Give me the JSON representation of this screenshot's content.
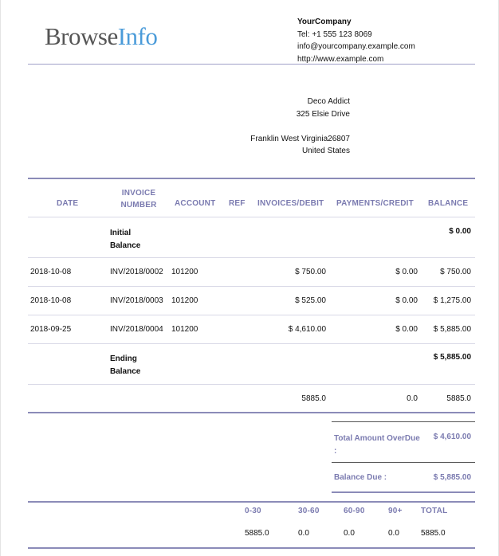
{
  "logo": {
    "part1": "Browse",
    "part2": "Info",
    "accent_color": "#4a9bd9"
  },
  "company": {
    "name": "YourCompany",
    "tel": "Tel: +1 555 123 8069",
    "email": "info@yourcompany.example.com",
    "website": "http://www.example.com"
  },
  "partner": {
    "name": "Deco Addict",
    "street": "325 Elsie Drive",
    "city_line": "Franklin West Virginia26807",
    "country": "United States"
  },
  "table": {
    "headers": {
      "date": "DATE",
      "invoice_line1": "INVOICE",
      "invoice_line2": "NUMBER",
      "account": "ACCOUNT",
      "ref": "REF",
      "debit": "INVOICES/DEBIT",
      "credit": "PAYMENTS/CREDIT",
      "balance": "BALANCE"
    },
    "initial": {
      "label_line1": "Initial",
      "label_line2": "Balance",
      "balance": "$ 0.00"
    },
    "rows": [
      {
        "date": "2018-10-08",
        "invoice": "INV/2018/0002",
        "account": "101200",
        "debit": "$ 750.00",
        "credit": "$ 0.00",
        "balance": "$ 750.00"
      },
      {
        "date": "2018-10-08",
        "invoice": "INV/2018/0003",
        "account": "101200",
        "debit": "$ 525.00",
        "credit": "$ 0.00",
        "balance": "$ 1,275.00"
      },
      {
        "date": "2018-09-25",
        "invoice": "INV/2018/0004",
        "account": "101200",
        "debit": "$ 4,610.00",
        "credit": "$ 0.00",
        "balance": "$ 5,885.00"
      }
    ],
    "ending": {
      "label_line1": "Ending",
      "label_line2": "Balance",
      "balance": "$ 5,885.00"
    },
    "totals": {
      "debit": "5885.0",
      "credit": "0.0",
      "balance": "5885.0"
    }
  },
  "summary": {
    "overdue_label_line1": "Total Amount OverDue",
    "overdue_label_line2": ":",
    "overdue_value": "$ 4,610.00",
    "balance_due_label": "Balance Due :",
    "balance_due_value": "$ 5,885.00"
  },
  "aging": {
    "headers": [
      "0-30",
      "30-60",
      "60-90",
      "90+",
      "TOTAL"
    ],
    "values": [
      "5885.0",
      "0.0",
      "0.0",
      "0.0",
      "5885.0"
    ]
  }
}
